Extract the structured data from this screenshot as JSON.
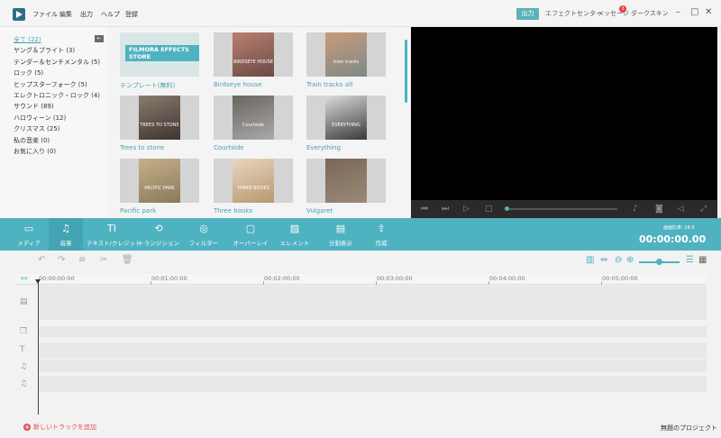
{
  "menu": [
    "ファイル",
    "編集",
    "出力",
    "ヘルプ",
    "登録"
  ],
  "header": {
    "export": "出力",
    "effect_center": "エフェクトセンター",
    "messages": "メッセージ",
    "message_count": "3",
    "dark_skin": "ダークスキン"
  },
  "collapse_glyph": "←",
  "categories": [
    {
      "label": "全て (22)",
      "active": true
    },
    {
      "label": "ヤング＆ブライト (3)"
    },
    {
      "label": "テンダー＆センチメンタル (5)"
    },
    {
      "label": "ロック (5)"
    },
    {
      "label": "ヒップスターフォーク (5)"
    },
    {
      "label": "エレクトロニック・ロック (4)"
    },
    {
      "label": "サウンド (89)"
    },
    {
      "label": "ハロウィーン (12)"
    },
    {
      "label": "クリスマス (25)"
    },
    {
      "label": "私の音楽 (0)"
    },
    {
      "label": "お気に入り (0)"
    }
  ],
  "library": {
    "items": [
      {
        "title": "テンプレート(無料)",
        "thumb_text": "FILMORA EFFECTS STORE"
      },
      {
        "title": "Birdseye house",
        "thumb_text": "BIRDSEYE HOUSE"
      },
      {
        "title": "Train tracks alt",
        "thumb_text": "train tracks"
      },
      {
        "title": "Trees to stone",
        "thumb_text": "TREES TO STONE"
      },
      {
        "title": "Courtside",
        "thumb_text": "Courtside"
      },
      {
        "title": "Everything",
        "thumb_text": "EVERYTHING"
      },
      {
        "title": "Pacific park",
        "thumb_text": "PACIFIC PARK"
      },
      {
        "title": "Three books",
        "thumb_text": "THREE BOOKS"
      },
      {
        "title": "Vulgaret",
        "thumb_text": ""
      }
    ]
  },
  "toolbar": {
    "items": [
      {
        "label": "メディア",
        "icon": "folder-icon"
      },
      {
        "label": "音楽",
        "icon": "music-icon"
      },
      {
        "label": "テキスト/クレジット",
        "icon": "text-icon"
      },
      {
        "label": "トランジション",
        "icon": "transition-icon"
      },
      {
        "label": "フィルター",
        "icon": "filter-icon"
      },
      {
        "label": "オーバーレイ",
        "icon": "overlay-icon"
      },
      {
        "label": "エレメント",
        "icon": "element-icon"
      },
      {
        "label": "分割表示",
        "icon": "split-icon"
      },
      {
        "label": "作成",
        "icon": "export-icon"
      }
    ],
    "aspect_ratio": "画面比率: 16:9",
    "timecode": "00:00:00.00"
  },
  "timeline": {
    "ruler": [
      "00:00:00:00",
      "00:01:00:00",
      "00:02:00:00",
      "00:03:00:00",
      "00:04:00:00",
      "00:05:00:00"
    ]
  },
  "footer": {
    "add_track": "新しいトラックを追加",
    "project": "無題のプロジェクト"
  },
  "colors": {
    "accent": "#4fb2c1",
    "link": "#4a9fb0",
    "add_track": "#e05050"
  }
}
